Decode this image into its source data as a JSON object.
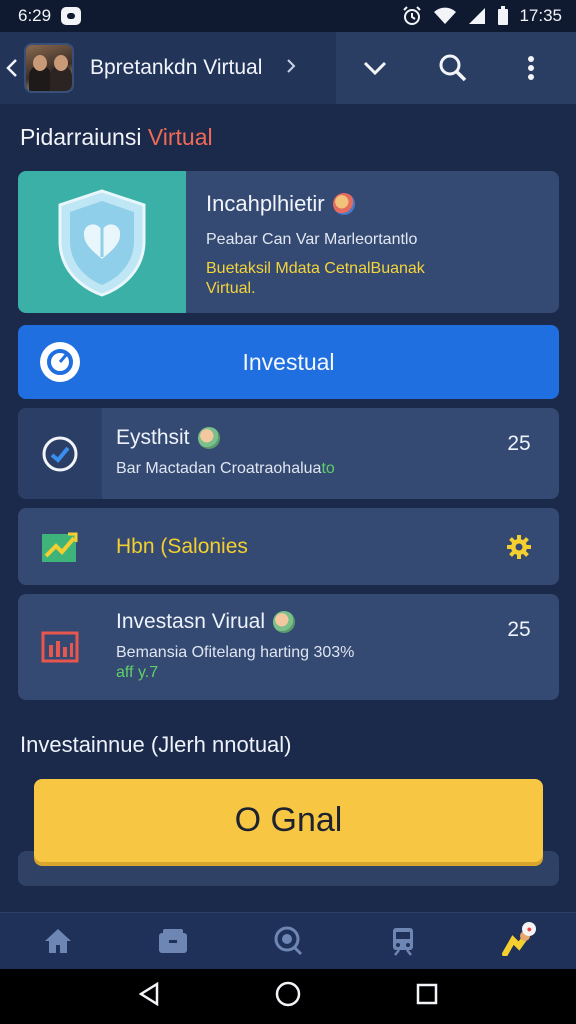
{
  "status_bar": {
    "time_left": "6:29",
    "time_right": "17:35",
    "icons": [
      "alarm-icon",
      "wifi-icon",
      "signal-icon",
      "battery-icon"
    ]
  },
  "header": {
    "title": "Bpretankdn Virtual",
    "icons": [
      "back-arrow-icon",
      "chevron-right-icon",
      "chevron-down-icon",
      "search-icon",
      "more-vert-icon"
    ]
  },
  "section_title": {
    "prefix": "Pidarraiunsi ",
    "accent": "Virtual"
  },
  "hero": {
    "icon": "shield-heart-icon",
    "title": "Incahplhietir",
    "subtitle": "Peabar Can Var Marleortantlo",
    "highlight_line1": "Buetaksil Mdata CetnalBuanak",
    "highlight_line2": "Virtual."
  },
  "primary_button": {
    "label": "Investual",
    "icon": "compass-icon"
  },
  "items": [
    {
      "title": "Eysthsit",
      "subtitle": "Bar Mactadan Croatraohalua",
      "subtitle_green": "to",
      "meta": "25",
      "icon": "check-circle-icon"
    },
    {
      "title": "Hbn (Salonies",
      "icon": "trend-chart-icon",
      "action_icon": "gear-icon"
    },
    {
      "title": "Investasn Virual",
      "subtitle": "Bemansia Ofitelang harting 303%",
      "subtitle2": "aff y.7",
      "meta": "25",
      "icon": "bar-chart-icon"
    }
  ],
  "invest_heading": "Investainnue (Jlerh nnotual)",
  "cta": {
    "label": "O Gnal"
  },
  "bottom_nav": [
    "home-icon",
    "wallet-icon",
    "search-badge-icon",
    "train-icon",
    "profile-icon"
  ],
  "colors": {
    "background": "#1b2a4a",
    "card": "#344a72",
    "primary": "#1f6fe0",
    "cta": "#f7c643",
    "accent_red": "#f06a55",
    "highlight_yellow": "#f5d43a",
    "hero_teal": "#3bb0a6"
  }
}
